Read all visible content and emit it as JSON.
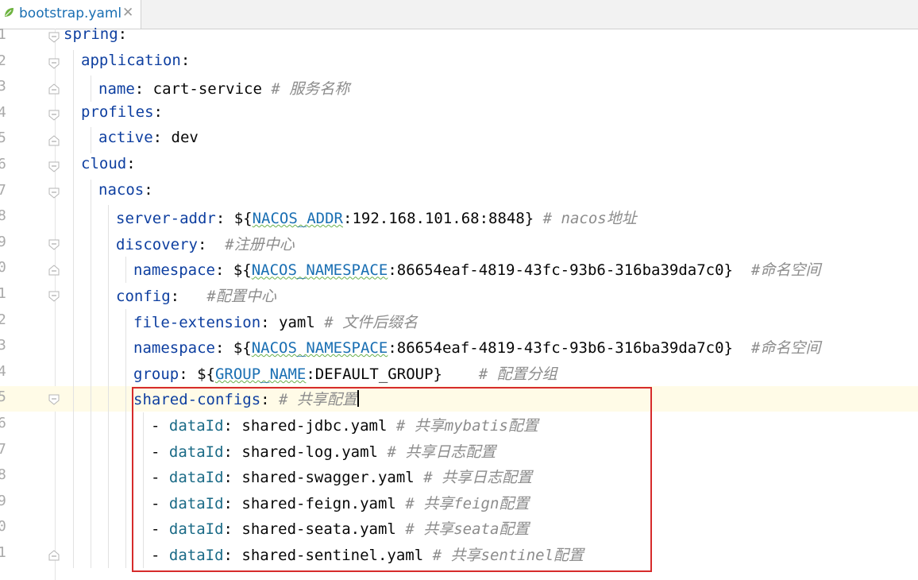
{
  "tab": {
    "filename": "bootstrap.yaml",
    "close": "✕"
  },
  "lines": [
    {
      "n": "1",
      "indent": 0,
      "fold": "open",
      "segments": [
        {
          "t": "spring",
          "c": "key"
        },
        {
          "t": ":",
          "c": ""
        }
      ]
    },
    {
      "n": "2",
      "indent": 1,
      "fold": "open",
      "segments": [
        {
          "t": "application",
          "c": "key"
        },
        {
          "t": ":",
          "c": ""
        }
      ]
    },
    {
      "n": "3",
      "indent": 2,
      "fold": "end",
      "segments": [
        {
          "t": "name",
          "c": "key"
        },
        {
          "t": ": cart-service ",
          "c": ""
        },
        {
          "t": "# 服务名称",
          "c": "cmt"
        }
      ]
    },
    {
      "n": "4",
      "indent": 1,
      "fold": "open",
      "segments": [
        {
          "t": "profiles",
          "c": "key"
        },
        {
          "t": ":",
          "c": ""
        }
      ]
    },
    {
      "n": "5",
      "indent": 2,
      "fold": "end",
      "segments": [
        {
          "t": "active",
          "c": "key"
        },
        {
          "t": ": dev",
          "c": ""
        }
      ]
    },
    {
      "n": "6",
      "indent": 1,
      "fold": "open",
      "segments": [
        {
          "t": "cloud",
          "c": "key"
        },
        {
          "t": ":",
          "c": ""
        }
      ]
    },
    {
      "n": "7",
      "indent": 2,
      "fold": "open",
      "segments": [
        {
          "t": "nacos",
          "c": "key"
        },
        {
          "t": ":",
          "c": ""
        }
      ]
    },
    {
      "n": "8",
      "indent": 3,
      "fold": "",
      "segments": [
        {
          "t": "server-addr",
          "c": "key"
        },
        {
          "t": ": ${",
          "c": ""
        },
        {
          "t": "NACOS_ADDR",
          "c": "var"
        },
        {
          "t": ":192.168.101.68:8848} ",
          "c": ""
        },
        {
          "t": "# nacos地址",
          "c": "cmt"
        }
      ]
    },
    {
      "n": "9",
      "indent": 3,
      "fold": "open",
      "segments": [
        {
          "t": "discovery",
          "c": "key"
        },
        {
          "t": ":  ",
          "c": ""
        },
        {
          "t": "#注册中心",
          "c": "cmt"
        }
      ]
    },
    {
      "n": "0",
      "indent": 4,
      "fold": "end",
      "segments": [
        {
          "t": "namespace",
          "c": "key"
        },
        {
          "t": ": ${",
          "c": ""
        },
        {
          "t": "NACOS_NAMESPACE",
          "c": "var"
        },
        {
          "t": ":86654eaf-4819-43fc-93b6-316ba39da7c0}  ",
          "c": ""
        },
        {
          "t": "#命名空间",
          "c": "cmt"
        }
      ]
    },
    {
      "n": "1",
      "indent": 3,
      "fold": "open",
      "segments": [
        {
          "t": "config",
          "c": "key"
        },
        {
          "t": ":   ",
          "c": ""
        },
        {
          "t": "#配置中心",
          "c": "cmt"
        }
      ]
    },
    {
      "n": "2",
      "indent": 4,
      "fold": "",
      "segments": [
        {
          "t": "file-extension",
          "c": "key"
        },
        {
          "t": ": yaml ",
          "c": ""
        },
        {
          "t": "# 文件后缀名",
          "c": "cmt"
        }
      ]
    },
    {
      "n": "3",
      "indent": 4,
      "fold": "",
      "segments": [
        {
          "t": "namespace",
          "c": "key"
        },
        {
          "t": ": ${",
          "c": ""
        },
        {
          "t": "NACOS_NAMESPACE",
          "c": "var"
        },
        {
          "t": ":86654eaf-4819-43fc-93b6-316ba39da7c0}  ",
          "c": ""
        },
        {
          "t": "#命名空间",
          "c": "cmt"
        }
      ]
    },
    {
      "n": "4",
      "indent": 4,
      "fold": "",
      "segments": [
        {
          "t": "group",
          "c": "key"
        },
        {
          "t": ": ${",
          "c": ""
        },
        {
          "t": "GROUP_NAME",
          "c": "var"
        },
        {
          "t": ":DEFAULT_GROUP}    ",
          "c": ""
        },
        {
          "t": "# 配置分组",
          "c": "cmt"
        }
      ]
    },
    {
      "n": "5",
      "indent": 4,
      "fold": "open",
      "current": true,
      "segments": [
        {
          "t": "shared-configs",
          "c": "key"
        },
        {
          "t": ": ",
          "c": ""
        },
        {
          "t": "# 共享配置",
          "c": "cmt"
        }
      ]
    },
    {
      "n": "6",
      "indent": 5,
      "fold": "",
      "segments": [
        {
          "t": "- ",
          "c": ""
        },
        {
          "t": "dataId",
          "c": "key2"
        },
        {
          "t": ": shared-jdbc.yaml ",
          "c": ""
        },
        {
          "t": "# 共享mybatis配置",
          "c": "cmt"
        }
      ]
    },
    {
      "n": "7",
      "indent": 5,
      "fold": "",
      "segments": [
        {
          "t": "- ",
          "c": ""
        },
        {
          "t": "dataId",
          "c": "key2"
        },
        {
          "t": ": shared-log.yaml ",
          "c": ""
        },
        {
          "t": "# 共享日志配置",
          "c": "cmt"
        }
      ]
    },
    {
      "n": "8",
      "indent": 5,
      "fold": "",
      "segments": [
        {
          "t": "- ",
          "c": ""
        },
        {
          "t": "dataId",
          "c": "key2"
        },
        {
          "t": ": shared-swagger.yaml ",
          "c": ""
        },
        {
          "t": "# 共享日志配置",
          "c": "cmt"
        }
      ]
    },
    {
      "n": "9",
      "indent": 5,
      "fold": "",
      "segments": [
        {
          "t": "- ",
          "c": ""
        },
        {
          "t": "dataId",
          "c": "key2"
        },
        {
          "t": ": shared-feign.yaml ",
          "c": ""
        },
        {
          "t": "# 共享feign配置",
          "c": "cmt"
        }
      ]
    },
    {
      "n": "0",
      "indent": 5,
      "fold": "",
      "segments": [
        {
          "t": "- ",
          "c": ""
        },
        {
          "t": "dataId",
          "c": "key2"
        },
        {
          "t": ": shared-seata.yaml ",
          "c": ""
        },
        {
          "t": "# 共享seata配置",
          "c": "cmt"
        }
      ]
    },
    {
      "n": "1",
      "indent": 5,
      "fold": "end",
      "segments": [
        {
          "t": "- ",
          "c": ""
        },
        {
          "t": "dataId",
          "c": "key2"
        },
        {
          "t": ": shared-sentinel.yaml ",
          "c": ""
        },
        {
          "t": "# 共享sentinel配置",
          "c": "cmt"
        }
      ]
    }
  ]
}
